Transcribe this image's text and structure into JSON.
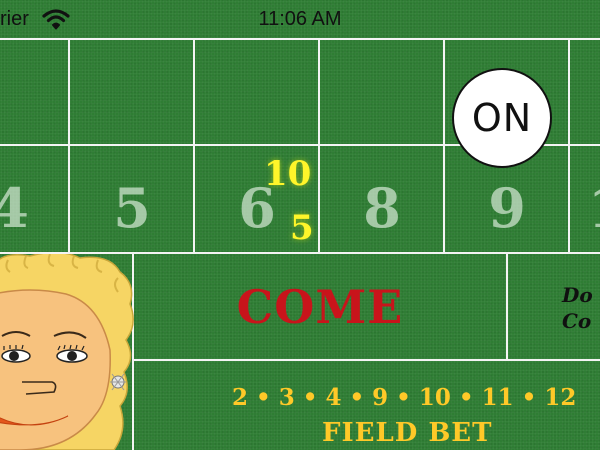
{
  "status_bar": {
    "carrier": "rier",
    "time": "11:06 AM",
    "wifi_icon": "wifi-icon"
  },
  "table": {
    "felt_color": "#2f7d34",
    "line_color": "#f4f4f4",
    "point_numbers": [
      "4",
      "5",
      "6",
      "8",
      "9",
      "1"
    ],
    "puck_label": "ON",
    "puck_on_point": "9",
    "bets_on_six": {
      "odds": "10",
      "line": "5"
    },
    "come_label": "COME",
    "dont_come_label": [
      "Do",
      "Co"
    ],
    "field_numbers": "2 • 3 • 4 • 9 • 10 • 11 • 12",
    "field_label": "FIELD BET",
    "come_color": "#c8141b",
    "field_color": "#ffc928",
    "chip_value_color": "#fff52a"
  },
  "dealer": {
    "avatar_icon": "dealer-avatar",
    "hair_color": "#f6d564",
    "skin_color": "#f7c27e"
  }
}
